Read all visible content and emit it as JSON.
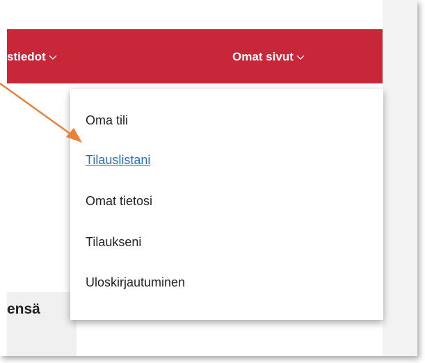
{
  "nav": {
    "left_label": "stiedot",
    "right_label": "Omat sivut"
  },
  "dropdown": {
    "items": [
      {
        "label": "Oma tili"
      },
      {
        "label": "Tilauslistani"
      },
      {
        "label": "Omat tietosi"
      },
      {
        "label": "Tilaukseni"
      },
      {
        "label": "Uloskirjautuminen"
      }
    ]
  },
  "page": {
    "heading_fragment": "ensä"
  },
  "colors": {
    "brand_red": "#c8273a",
    "link_blue": "#2a6ebb",
    "annotation_orange": "#e8823a"
  },
  "icons": {
    "nav_chevron": "chevron-down-icon",
    "annotation": "arrow-icon"
  }
}
